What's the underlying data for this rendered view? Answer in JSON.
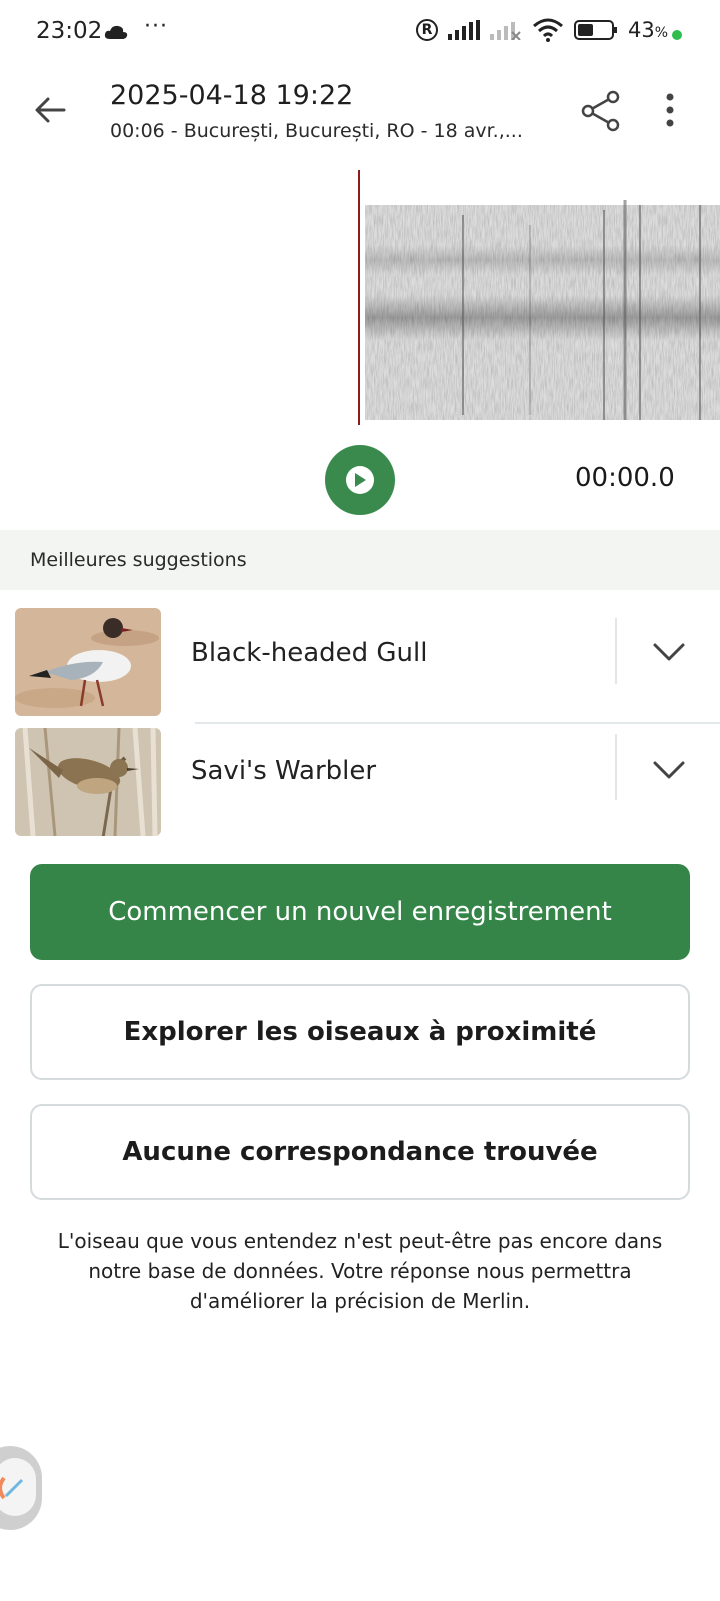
{
  "status_bar": {
    "time": "23:02",
    "more": "···",
    "battery": "43",
    "battery_unit": "%"
  },
  "header": {
    "title": "2025-04-18 19:22",
    "subtitle": "00:06 - București, București, RO - 18 avr.,..."
  },
  "player": {
    "timer": "00:00.0"
  },
  "suggestions": {
    "title": "Meilleures suggestions",
    "items": [
      {
        "name": "Black-headed Gull"
      },
      {
        "name": "Savi's Warbler"
      }
    ]
  },
  "actions": {
    "new_recording": "Commencer un nouvel enregistrement",
    "explore_nearby": "Explorer les oiseaux à proximité",
    "no_match": "Aucune correspondance trouvée"
  },
  "note": "L'oiseau que vous entendez n'est peut-être pas encore dans notre base de données. Votre réponse nous permettra d'améliorer la précision de Merlin.",
  "colors": {
    "primary_green": "#358548",
    "play_green": "#3a8a4e",
    "cursor_red": "#8b1c1c"
  },
  "icons": [
    "back-arrow-icon",
    "share-icon",
    "more-vert-icon",
    "play-icon",
    "chevron-down-icon",
    "cloud-icon",
    "wifi-icon",
    "signal-icon",
    "battery-icon"
  ]
}
